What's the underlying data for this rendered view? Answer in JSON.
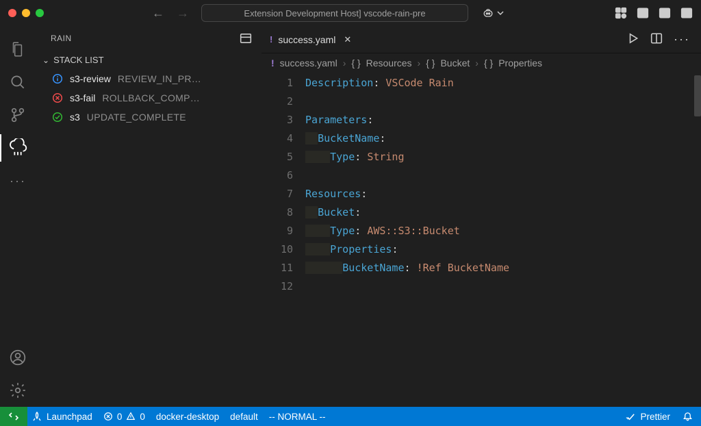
{
  "title": "Extension Development Host] vscode-rain-pre",
  "sidepanel": {
    "title": "RAIN",
    "section": "STACK LIST",
    "items": [
      {
        "name": "s3-review",
        "status": "REVIEW_IN_PR…",
        "icon": "info",
        "color": "#3794ff"
      },
      {
        "name": "s3-fail",
        "status": "ROLLBACK_COMP…",
        "icon": "error",
        "color": "#f14c4c"
      },
      {
        "name": "s3",
        "status": "UPDATE_COMPLETE",
        "icon": "pass",
        "color": "#33b934"
      }
    ]
  },
  "tab": {
    "filename": "success.yaml"
  },
  "breadcrumb": [
    "success.yaml",
    "Resources",
    "Bucket",
    "Properties"
  ],
  "code": {
    "l1_key": "Description",
    "l1_val": "VSCode Rain",
    "l3_key": "Parameters",
    "l4_key": "BucketName",
    "l5_key": "Type",
    "l5_val": "String",
    "l7_key": "Resources",
    "l8_key": "Bucket",
    "l9_key": "Type",
    "l9_val": "AWS::S3::Bucket",
    "l10_key": "Properties",
    "l11_key": "BucketName",
    "l11_tag": "!Ref",
    "l11_ref": "BucketName"
  },
  "lines": [
    "1",
    "2",
    "3",
    "4",
    "5",
    "6",
    "7",
    "8",
    "9",
    "10",
    "11",
    "12"
  ],
  "status": {
    "launchpad": "Launchpad",
    "errors": "0",
    "warnings": "0",
    "context": "docker-desktop",
    "namespace": "default",
    "mode": "-- NORMAL --",
    "formatter": "Prettier"
  }
}
